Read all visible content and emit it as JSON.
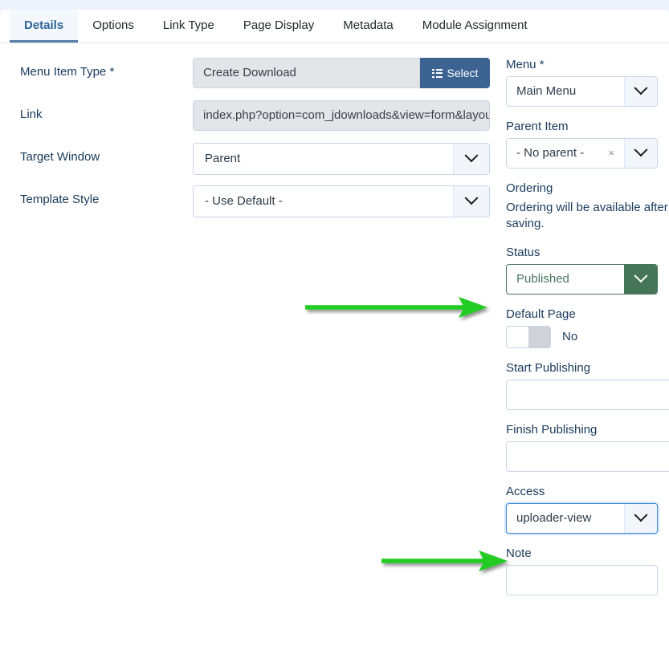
{
  "tabs": [
    {
      "label": "Details",
      "active": true
    },
    {
      "label": "Options",
      "active": false
    },
    {
      "label": "Link Type",
      "active": false
    },
    {
      "label": "Page Display",
      "active": false
    },
    {
      "label": "Metadata",
      "active": false
    },
    {
      "label": "Module Assignment",
      "active": false
    }
  ],
  "left": {
    "menu_item_type": {
      "label": "Menu Item Type *",
      "value": "Create Download",
      "select_button": "Select",
      "select_icon": "list-ul-icon"
    },
    "link": {
      "label": "Link",
      "value": "index.php?option=com_jdownloads&view=form&layou"
    },
    "target_window": {
      "label": "Target Window",
      "value": "Parent"
    },
    "template_style": {
      "label": "Template Style",
      "value": "- Use Default -"
    }
  },
  "right": {
    "menu": {
      "label": "Menu *",
      "value": "Main Menu"
    },
    "parent_item": {
      "label": "Parent Item",
      "value": "- No parent -",
      "clear": "×"
    },
    "ordering": {
      "label": "Ordering",
      "help": "Ordering will be available after saving."
    },
    "status": {
      "label": "Status",
      "value": "Published",
      "color": "#46755a"
    },
    "default_page": {
      "label": "Default Page",
      "value": "No",
      "state": "off"
    },
    "start_publishing": {
      "label": "Start Publishing",
      "value": "",
      "calendar_icon": "calendar-icon"
    },
    "finish_publishing": {
      "label": "Finish Publishing",
      "value": "",
      "calendar_icon": "calendar-icon"
    },
    "access": {
      "label": "Access",
      "value": "uploader-view"
    },
    "note": {
      "label": "Note",
      "value": ""
    }
  },
  "annotations": {
    "color": "#22cc22",
    "arrow_status": "arrow-pointing-to-status",
    "arrow_access": "arrow-pointing-to-access"
  }
}
